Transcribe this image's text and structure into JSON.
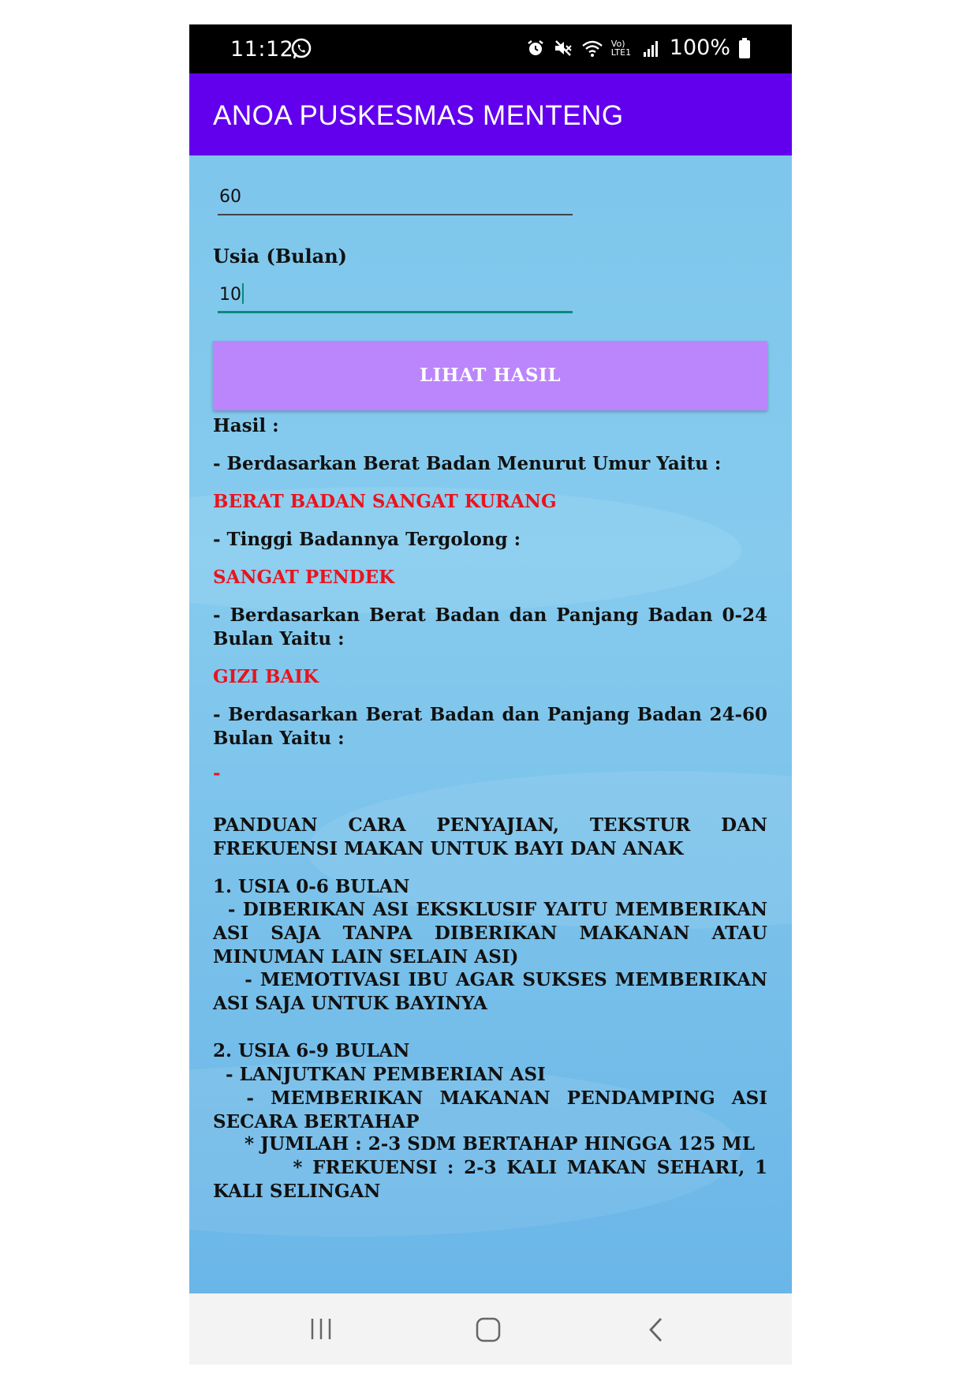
{
  "status_bar": {
    "time": "11:12",
    "battery_percent": "100%",
    "network_label": "Vo) LTE1"
  },
  "app_bar": {
    "title": "ANOA PUSKESMAS MENTENG"
  },
  "form": {
    "first_field_value": "60",
    "age_label": "Usia (Bulan)",
    "age_value": "10",
    "submit_label": "LIHAT HASIL"
  },
  "results": {
    "heading": "Hasil :",
    "weight_for_age_label": "- Berdasarkan Berat Badan Menurut Umur Yaitu :",
    "weight_for_age_value": "BERAT BADAN SANGAT KURANG",
    "height_label": "- Tinggi Badannya Tergolong :",
    "height_value": "SANGAT PENDEK",
    "wfl_0_24_label": "- Berdasarkan Berat Badan dan Panjang Badan 0-24 Bulan Yaitu :",
    "wfl_0_24_value": "GIZI BAIK",
    "wfl_24_60_label": "- Berdasarkan Berat Badan dan Panjang Badan 24-60 Bulan Yaitu :",
    "wfl_24_60_value": "-"
  },
  "guide": {
    "title": "PANDUAN CARA PENYAJIAN, TEKSTUR DAN FREKUENSI MAKAN UNTUK BAYI DAN ANAK",
    "section1_title": "1. USIA 0-6 BULAN",
    "section1_item1": "  - DIBERIKAN ASI EKSKLUSIF YAITU MEMBERIKAN ASI SAJA TANPA DIBERIKAN MAKANAN ATAU MINUMAN LAIN SELAIN ASI)",
    "section1_item2": "    - MEMOTIVASI IBU AGAR SUKSES MEMBERIKAN ASI SAJA UNTUK BAYINYA",
    "section2_title": "2. USIA 6-9 BULAN",
    "section2_item1": "  - LANJUTKAN PEMBERIAN ASI",
    "section2_item2": "  - MEMBERIKAN MAKANAN PENDAMPING ASI SECARA BERTAHAP",
    "section2_item3": "     * JUMLAH : 2-3 SDM BERTAHAP HINGGA 125 ML",
    "section2_item4": "        * FREKUENSI : 2-3 KALI MAKAN SEHARI, 1 KALI SELINGAN"
  },
  "colors": {
    "app_bar": "#6200ee",
    "button": "#bb86fc",
    "background": "#7cc3ea",
    "result_red": "#e8141e",
    "input_focus": "#0b8a7c"
  },
  "icons": {
    "status": [
      "whatsapp-icon",
      "alarm-icon",
      "mute-icon",
      "wifi-icon",
      "signal-icon",
      "battery-icon"
    ],
    "navigation": [
      "recent-apps-icon",
      "home-icon",
      "back-icon"
    ]
  }
}
